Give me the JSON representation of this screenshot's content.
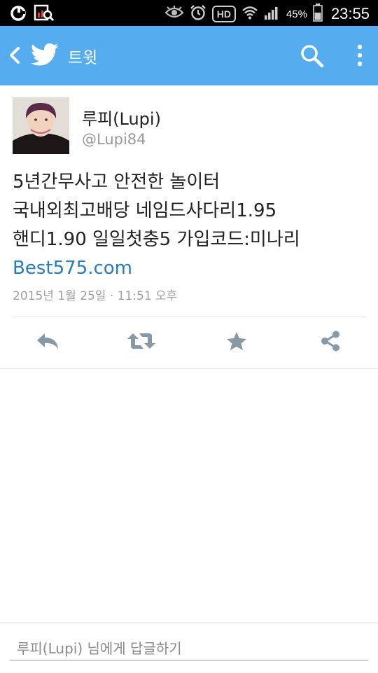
{
  "status_bar": {
    "battery_percent": "45%",
    "time": "23:55",
    "hd_label": "HD"
  },
  "app_bar": {
    "title": "트윗"
  },
  "tweet": {
    "author_name": "루피(Lupi)",
    "author_handle": "@Lupi84",
    "lines": [
      "5년간무사고 안전한 놀이터",
      "국내외최고배당 네임드사다리1.95",
      "핸디1.90 일일첫충5 가입코드:미나리"
    ],
    "link_text": "Best575.com",
    "timestamp": "2015년 1월 25일 · 11:51 오후"
  },
  "reply": {
    "placeholder": "루피(Lupi) 님에게 답글하기"
  },
  "colors": {
    "app_bar": "#55acee",
    "link": "#2b7bb9",
    "action_icon": "#8899a6"
  }
}
